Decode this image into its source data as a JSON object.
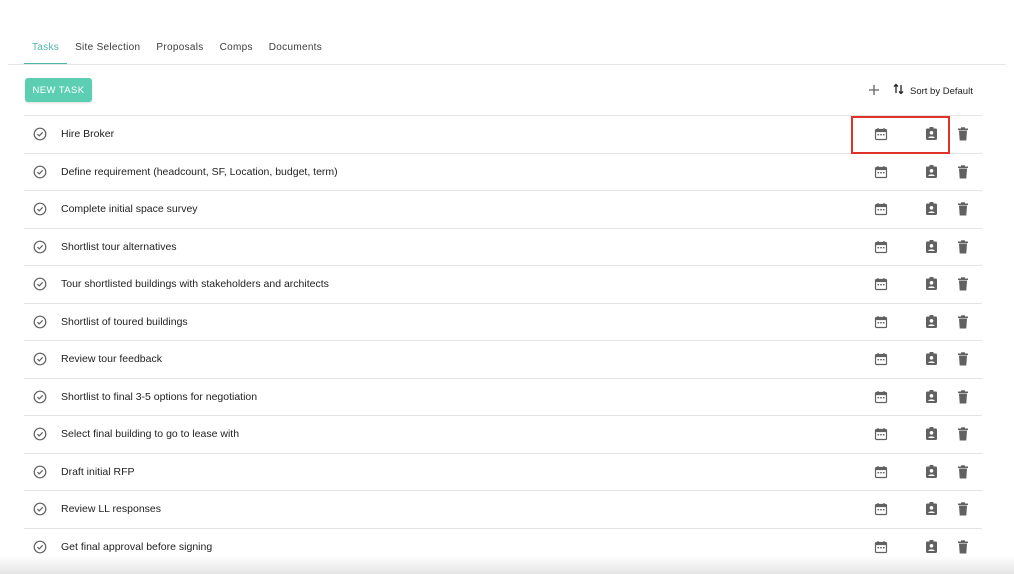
{
  "tabs": [
    {
      "label": "Tasks",
      "active": true
    },
    {
      "label": "Site Selection",
      "active": false
    },
    {
      "label": "Proposals",
      "active": false
    },
    {
      "label": "Comps",
      "active": false
    },
    {
      "label": "Documents",
      "active": false
    }
  ],
  "toolbar": {
    "new_task_label": "NEW TASK",
    "add_icon": "plus-icon",
    "sort_icon": "sort-arrows-icon",
    "sort_label": "Sort by Default"
  },
  "tasks": [
    {
      "label": "Hire Broker"
    },
    {
      "label": "Define requirement (headcount, SF, Location, budget, term)"
    },
    {
      "label": "Complete initial space survey"
    },
    {
      "label": "Shortlist tour alternatives"
    },
    {
      "label": "Tour shortlisted buildings with stakeholders and architects"
    },
    {
      "label": "Shortlist of toured buildings"
    },
    {
      "label": "Review tour feedback"
    },
    {
      "label": "Shortlist to final 3-5 options for negotiation"
    },
    {
      "label": "Select final building to go to lease with"
    },
    {
      "label": "Draft initial RFP"
    },
    {
      "label": "Review LL responses"
    },
    {
      "label": "Get final approval before signing"
    }
  ],
  "row_icons": {
    "check": "check-circle-icon",
    "date": "calendar-icon",
    "assign": "assignee-icon",
    "delete": "trash-icon"
  },
  "colors": {
    "accent": "#4db6ac",
    "button": "#5ccfb3",
    "highlight": "#e0322a",
    "icon": "#616161"
  }
}
